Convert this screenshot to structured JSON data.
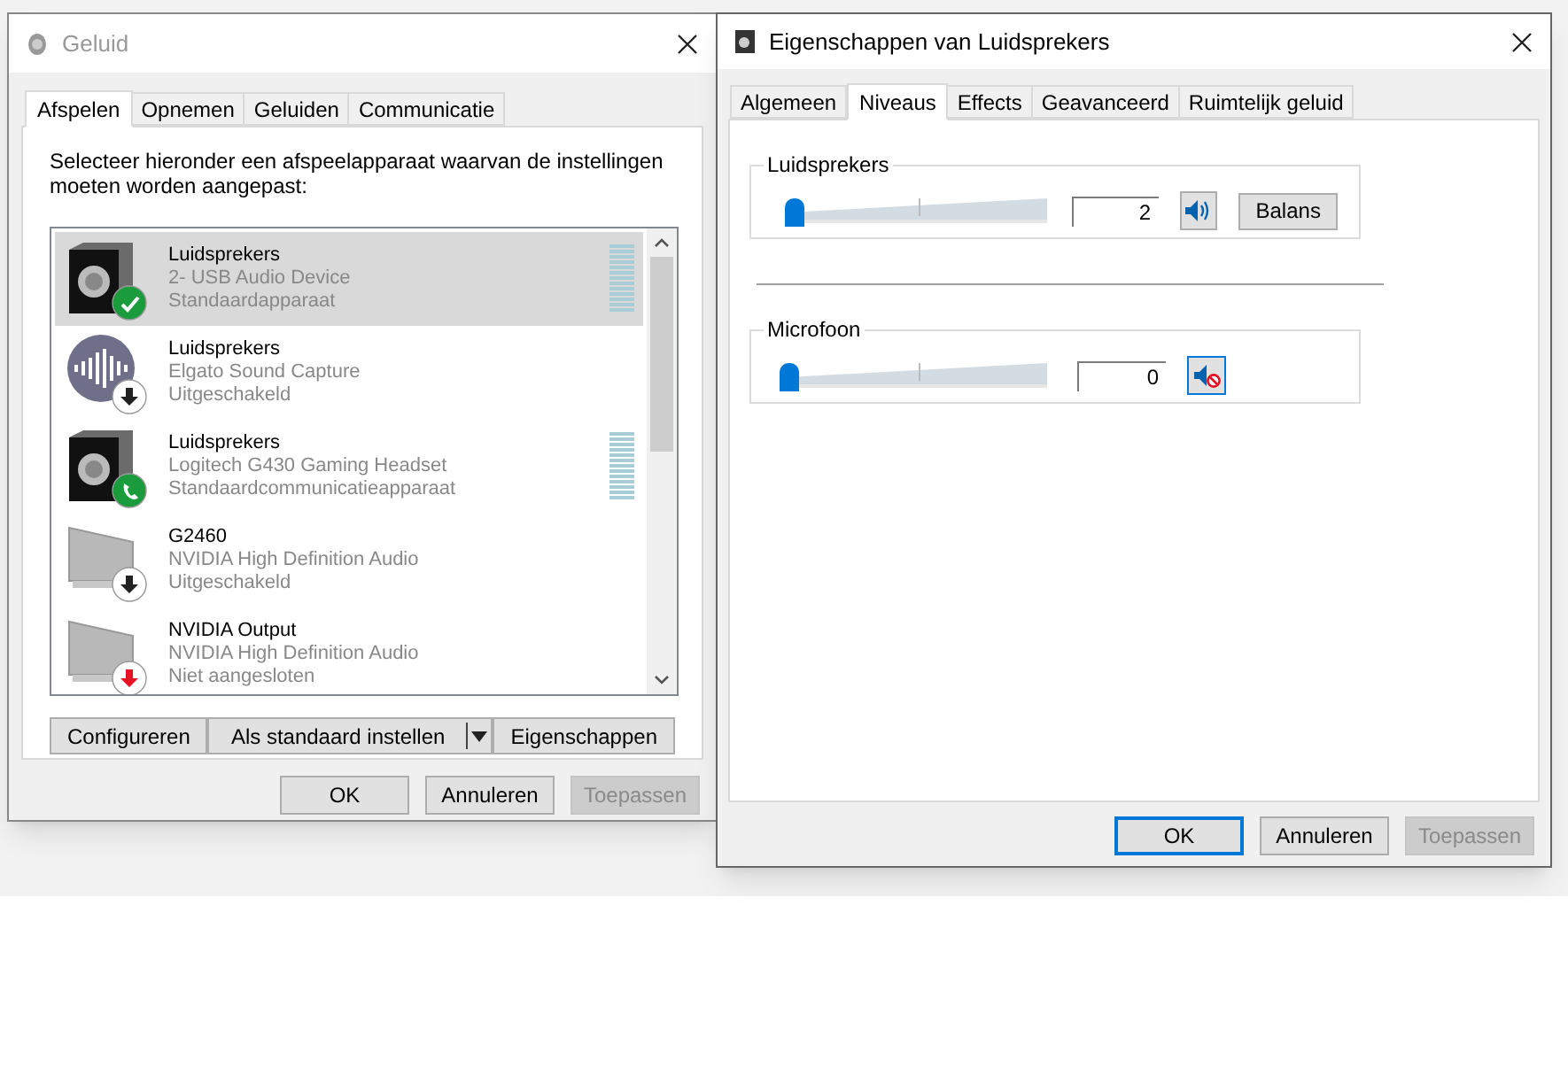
{
  "sound_window": {
    "title": "Geluid",
    "tabs": [
      {
        "label": "Afspelen",
        "selected": true
      },
      {
        "label": "Opnemen",
        "selected": false
      },
      {
        "label": "Geluiden",
        "selected": false
      },
      {
        "label": "Communicatie",
        "selected": false
      }
    ],
    "instruction": "Selecteer hieronder een afspeelapparaat waarvan de instellingen moeten worden aangepast:",
    "devices": [
      {
        "name": "Luidsprekers",
        "description": "2- USB Audio Device",
        "status": "Standaardapparaat",
        "kind": "default",
        "selected": true,
        "meter": true
      },
      {
        "name": "Luidsprekers",
        "description": "Elgato Sound Capture",
        "status": "Uitgeschakeld",
        "kind": "capture",
        "selected": false,
        "meter": false
      },
      {
        "name": "Luidsprekers",
        "description": "Logitech G430 Gaming Headset",
        "status": "Standaardcommunicatieapparaat",
        "kind": "communication",
        "selected": false,
        "meter": true
      },
      {
        "name": "G2460",
        "description": "NVIDIA High Definition Audio",
        "status": "Uitgeschakeld",
        "kind": "disabled",
        "selected": false,
        "meter": false
      },
      {
        "name": "NVIDIA Output",
        "description": "NVIDIA High Definition Audio",
        "status": "Niet aangesloten",
        "kind": "unplugged",
        "selected": false,
        "meter": false
      }
    ],
    "buttons": [
      {
        "label": "Configureren",
        "kind": "plain"
      },
      {
        "label": "Als standaard instellen",
        "kind": "split"
      },
      {
        "label": "Eigenschappen",
        "kind": "plain"
      }
    ],
    "dialog_buttons": [
      {
        "label": "OK",
        "default": false,
        "disabled": false
      },
      {
        "label": "Annuleren",
        "default": false,
        "disabled": false
      },
      {
        "label": "Toepassen",
        "default": false,
        "disabled": true
      }
    ]
  },
  "properties_window": {
    "title": "Eigenschappen van Luidsprekers",
    "tabs": [
      {
        "label": "Algemeen",
        "selected": false
      },
      {
        "label": "Niveaus",
        "selected": true
      },
      {
        "label": "Effects",
        "selected": false
      },
      {
        "label": "Geavanceerd",
        "selected": false
      },
      {
        "label": "Ruimtelijk geluid",
        "selected": false
      }
    ],
    "levels": [
      {
        "label": "Luidsprekers",
        "level": 0.02,
        "value": "2",
        "muted": false,
        "balance_button": "Balans"
      },
      {
        "label": "Microfoon",
        "level": 0,
        "value": "0",
        "muted": true
      }
    ],
    "dialog_buttons": [
      {
        "label": "OK",
        "default": true,
        "disabled": false
      },
      {
        "label": "Annuleren",
        "default": false,
        "disabled": false
      },
      {
        "label": "Toepassen",
        "default": false,
        "disabled": true
      }
    ]
  }
}
